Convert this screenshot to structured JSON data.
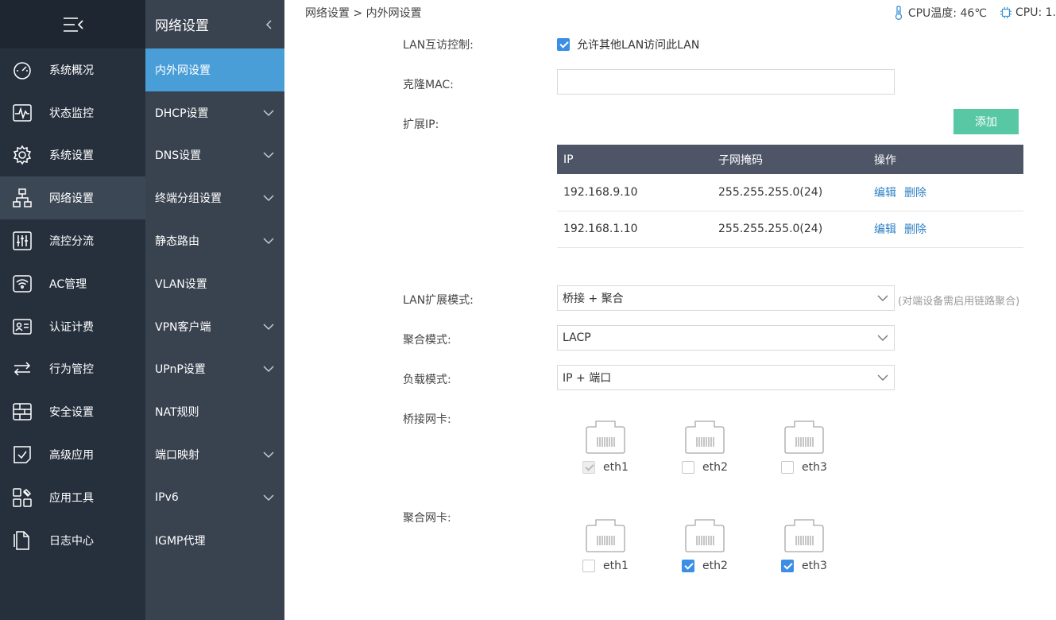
{
  "nav_main": {
    "items": [
      {
        "label": "系统概况",
        "icon": "dashboard-icon"
      },
      {
        "label": "状态监控",
        "icon": "monitor-icon"
      },
      {
        "label": "系统设置",
        "icon": "gear-icon"
      },
      {
        "label": "网络设置",
        "icon": "network-icon",
        "active": true
      },
      {
        "label": "流控分流",
        "icon": "sliders-icon"
      },
      {
        "label": "AC管理",
        "icon": "wifi-icon"
      },
      {
        "label": "认证计费",
        "icon": "id-card-icon"
      },
      {
        "label": "行为管控",
        "icon": "swap-arrows-icon"
      },
      {
        "label": "安全设置",
        "icon": "firewall-icon"
      },
      {
        "label": "高级应用",
        "icon": "checklist-icon"
      },
      {
        "label": "应用工具",
        "icon": "tools-icon"
      },
      {
        "label": "日志中心",
        "icon": "document-icon"
      }
    ]
  },
  "nav_sub": {
    "title": "网络设置",
    "items": [
      {
        "label": "内外网设置",
        "active": true,
        "expandable": false
      },
      {
        "label": "DHCP设置",
        "expandable": true
      },
      {
        "label": "DNS设置",
        "expandable": true
      },
      {
        "label": "终端分组设置",
        "expandable": true
      },
      {
        "label": "静态路由",
        "expandable": true
      },
      {
        "label": "VLAN设置",
        "expandable": false
      },
      {
        "label": "VPN客户端",
        "expandable": true
      },
      {
        "label": "UPnP设置",
        "expandable": true
      },
      {
        "label": "NAT规则",
        "expandable": false
      },
      {
        "label": "端口映射",
        "expandable": true
      },
      {
        "label": "IPv6",
        "expandable": true
      },
      {
        "label": "IGMP代理",
        "expandable": false
      }
    ]
  },
  "topbar": {
    "breadcrumb": "网络设置 > 内外网设置",
    "cpu_temp": "CPU温度: 46℃",
    "cpu_usage": "CPU: 1."
  },
  "form": {
    "lan_access_label": "LAN互访控制:",
    "lan_access_checkbox": "允许其他LAN访问此LAN",
    "clone_mac_label": "克隆MAC:",
    "clone_mac_value": "",
    "ext_ip_label": "扩展IP:",
    "add_button": "添加",
    "table": {
      "headers": [
        "IP",
        "子网掩码",
        "操作"
      ],
      "rows": [
        {
          "ip": "192.168.9.10",
          "mask": "255.255.255.0(24)"
        },
        {
          "ip": "192.168.1.10",
          "mask": "255.255.255.0(24)"
        }
      ],
      "edit": "编辑",
      "delete": "删除"
    },
    "lan_mode_label": "LAN扩展模式:",
    "lan_mode_value": "桥接 + 聚合",
    "lan_mode_note": "(对端设备需启用链路聚合)",
    "agg_mode_label": "聚合模式:",
    "agg_mode_value": "LACP",
    "load_mode_label": "负载模式:",
    "load_mode_value": "IP + 端口",
    "bridge_nic_label": "桥接网卡:",
    "agg_nic_label": "聚合网卡:",
    "bridge_ports": [
      {
        "name": "eth1",
        "state": "disabled-checked"
      },
      {
        "name": "eth2",
        "state": "unchecked"
      },
      {
        "name": "eth3",
        "state": "unchecked"
      }
    ],
    "agg_ports": [
      {
        "name": "eth1",
        "state": "unchecked"
      },
      {
        "name": "eth2",
        "state": "checked"
      },
      {
        "name": "eth3",
        "state": "checked"
      }
    ]
  }
}
